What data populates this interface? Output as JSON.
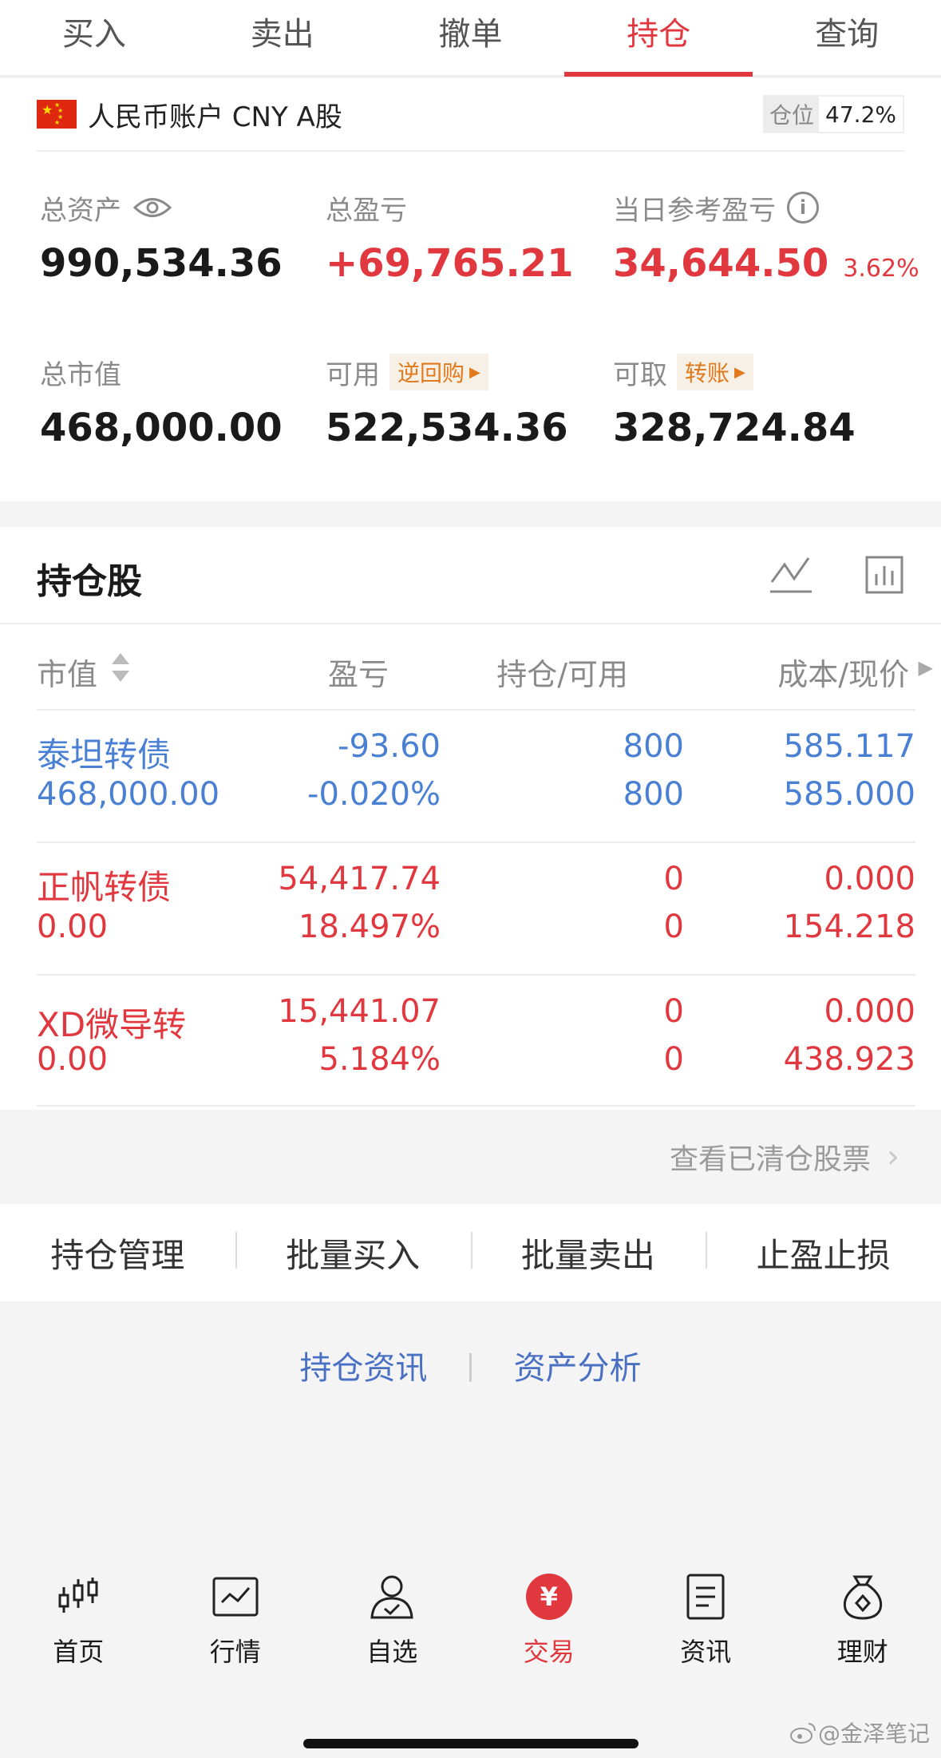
{
  "tabs": [
    {
      "label": "买入"
    },
    {
      "label": "卖出"
    },
    {
      "label": "撤单"
    },
    {
      "label": "持仓",
      "active": true
    },
    {
      "label": "查询"
    }
  ],
  "account": {
    "name": "人民币账户 CNY A股",
    "position_label": "仓位",
    "position_value": "47.2%"
  },
  "stats": {
    "total_assets": {
      "label": "总资产",
      "value": "990,534.36"
    },
    "total_pl": {
      "label": "总盈亏",
      "value": "+69,765.21"
    },
    "daily_pl": {
      "label": "当日参考盈亏",
      "value": "34,644.50",
      "pct": "3.62%"
    },
    "market_value": {
      "label": "总市值",
      "value": "468,000.00"
    },
    "available": {
      "label": "可用",
      "tag": "逆回购",
      "value": "522,534.36"
    },
    "withdrawable": {
      "label": "可取",
      "tag": "转账",
      "value": "328,724.84"
    }
  },
  "holdings": {
    "title": "持仓股",
    "columns": {
      "market_value": "市值",
      "pl": "盈亏",
      "qty": "持仓/可用",
      "cost": "成本/现价"
    },
    "rows": [
      {
        "name": "泰坦转债",
        "market_value": "468,000.00",
        "pl": "-93.60",
        "pl_pct": "-0.020%",
        "position": "800",
        "available": "800",
        "cost": "585.117",
        "price": "585.000",
        "color": "blue"
      },
      {
        "name": "正帆转债",
        "market_value": "0.00",
        "pl": "54,417.74",
        "pl_pct": "18.497%",
        "position": "0",
        "available": "0",
        "cost": "0.000",
        "price": "154.218",
        "color": "red"
      },
      {
        "name": "XD微导转",
        "market_value": "0.00",
        "pl": "15,441.07",
        "pl_pct": "5.184%",
        "position": "0",
        "available": "0",
        "cost": "0.000",
        "price": "438.923",
        "color": "red"
      }
    ]
  },
  "cleared_link": "查看已清仓股票",
  "actions": [
    {
      "label": "持仓管理"
    },
    {
      "label": "批量买入"
    },
    {
      "label": "批量卖出"
    },
    {
      "label": "止盈止损"
    }
  ],
  "links": {
    "left": "持仓资讯",
    "right": "资产分析"
  },
  "bottom_nav": [
    {
      "label": "首页",
      "icon": "candlestick-icon"
    },
    {
      "label": "行情",
      "icon": "chart-icon"
    },
    {
      "label": "自选",
      "icon": "user-check-icon"
    },
    {
      "label": "交易",
      "icon": "yen-icon",
      "active": true
    },
    {
      "label": "资讯",
      "icon": "document-icon"
    },
    {
      "label": "理财",
      "icon": "money-bag-icon"
    }
  ],
  "watermark": "@金泽笔记",
  "colors": {
    "accent_red": "#e0383e",
    "accent_blue": "#4a80d4",
    "tag_orange": "#e07a1c"
  }
}
